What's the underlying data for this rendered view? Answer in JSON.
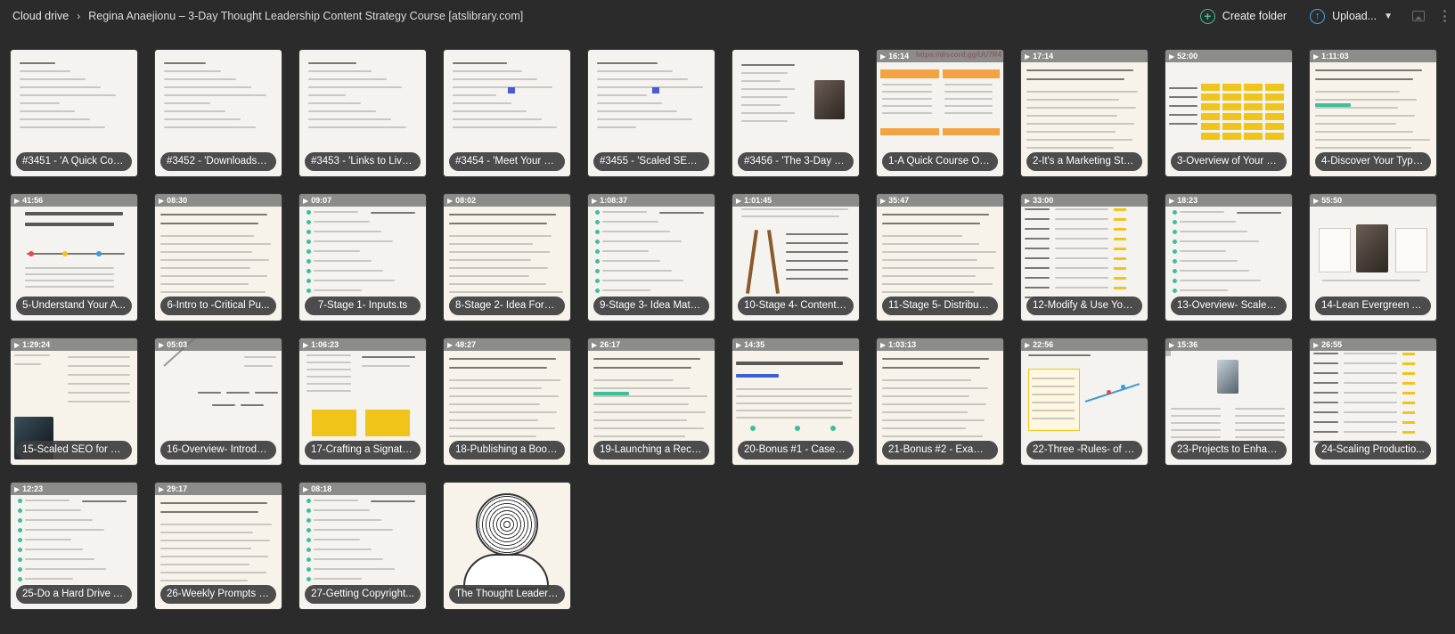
{
  "breadcrumb": {
    "root": "Cloud drive",
    "separator": "›",
    "current": "Regina Anaejionu – 3-Day Thought Leadership Content Strategy Course [atslibrary.com]"
  },
  "actions": {
    "create_folder": "Create folder",
    "upload": "Upload..."
  },
  "colors": {
    "background": "#2b2b2b",
    "create_folder_icon": "#3fc08a",
    "upload_icon": "#4aa3f0"
  },
  "tiles": [
    {
      "label": "#3451 - 'A Quick Cou...",
      "duration": "",
      "style": "doc"
    },
    {
      "label": "#3452 - 'Downloads_ ...",
      "duration": "",
      "style": "doc"
    },
    {
      "label": "#3453 - 'Links to Live...",
      "duration": "",
      "style": "doc"
    },
    {
      "label": "#3454 - 'Meet Your C...",
      "duration": "",
      "style": "doc"
    },
    {
      "label": "#3455 - 'Scaled SEO f...",
      "duration": "",
      "style": "doc"
    },
    {
      "label": "#3456 - 'The 3-Day T...",
      "duration": "",
      "style": "doc-photo"
    },
    {
      "label": "1-A Quick Course Ori...",
      "duration": "16:14",
      "style": "orange",
      "overlay_text": "https://discord.gg/UU7R4"
    },
    {
      "label": "2-It's a Marketing Stra...",
      "duration": "17:14",
      "style": "text"
    },
    {
      "label": "3-Overview of Your N...",
      "duration": "52:00",
      "style": "yellow-grid"
    },
    {
      "label": "4-Discover Your Type ...",
      "duration": "1:11:03",
      "style": "text"
    },
    {
      "label": "5-Understand Your A...",
      "duration": "41:56",
      "style": "timeline"
    },
    {
      "label": "6-Intro to -Critical Pu...",
      "duration": "08:30",
      "style": "text"
    },
    {
      "label": "7-Stage 1- Inputs.ts",
      "duration": "09:07",
      "style": "list-green"
    },
    {
      "label": "8-Stage 2- Idea Form...",
      "duration": "08:02",
      "style": "text"
    },
    {
      "label": "9-Stage 3- Idea Matur...",
      "duration": "1:08:37",
      "style": "list-green"
    },
    {
      "label": "10-Stage 4- Content ...",
      "duration": "1:01:45",
      "style": "ladder"
    },
    {
      "label": "11-Stage 5- Distributi...",
      "duration": "35:47",
      "style": "text"
    },
    {
      "label": "12-Modify & Use You...",
      "duration": "33:00",
      "style": "table"
    },
    {
      "label": "13-Overview- Scaled ...",
      "duration": "18:23",
      "style": "list-green"
    },
    {
      "label": "14-Lean Evergreen A...",
      "duration": "55:50",
      "style": "flow-photo"
    },
    {
      "label": "15-Scaled SEO for Th...",
      "duration": "1:29:24",
      "style": "dark-photo"
    },
    {
      "label": "16-Overview- Introdu...",
      "duration": "05:03",
      "style": "diagonal"
    },
    {
      "label": "17-Crafting a Signatur...",
      "duration": "1:06:23",
      "style": "yellow-boxes"
    },
    {
      "label": "18-Publishing a Book ...",
      "duration": "48:27",
      "style": "text"
    },
    {
      "label": "19-Launching a Recur...",
      "duration": "26:17",
      "style": "text"
    },
    {
      "label": "20-Bonus #1 - Case S...",
      "duration": "14:35",
      "style": "bigtext"
    },
    {
      "label": "21-Bonus #2 - Examp...",
      "duration": "1:03:13",
      "style": "text"
    },
    {
      "label": "22-Three -Rules- of T...",
      "duration": "22:56",
      "style": "chart"
    },
    {
      "label": "23-Projects to Enhan...",
      "duration": "15:36",
      "style": "laptop"
    },
    {
      "label": "24-Scaling Productio...",
      "duration": "26:55",
      "style": "table"
    },
    {
      "label": "25-Do a Hard Drive A...",
      "duration": "12:23",
      "style": "list-green"
    },
    {
      "label": "26-Weekly Prompts a...",
      "duration": "29:17",
      "style": "text"
    },
    {
      "label": "27-Getting Copyright...",
      "duration": "08:18",
      "style": "list-green"
    },
    {
      "label": "The Thought Leaders...",
      "duration": "",
      "style": "sketch"
    }
  ]
}
